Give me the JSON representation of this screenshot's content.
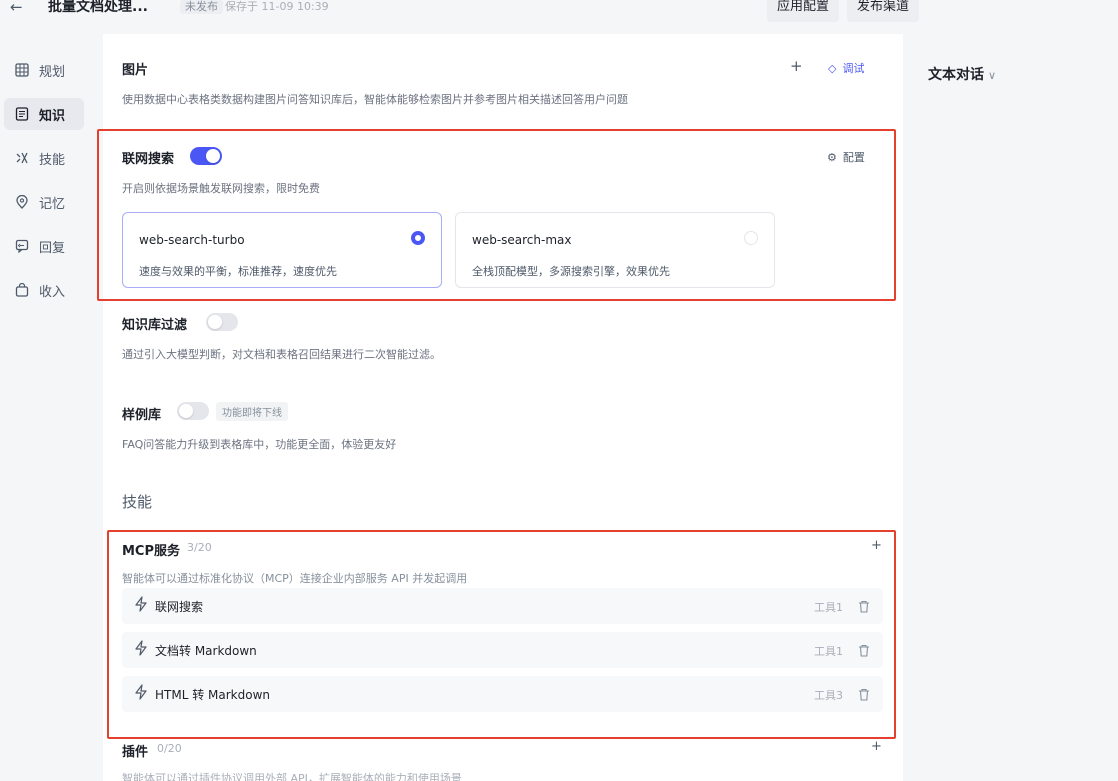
{
  "topbar": {
    "back_icon": "arrow-left-icon",
    "title": "批量文档处理...",
    "status": "未发布",
    "saved": "保存于 11-09 10:39",
    "app_config_label": "应用配置",
    "publish_label": "发布渠道"
  },
  "nav": {
    "items": [
      {
        "label": "规划",
        "icon": "grid-icon",
        "active": false
      },
      {
        "label": "知识",
        "icon": "book-icon",
        "active": true
      },
      {
        "label": "技能",
        "icon": "skill-icon",
        "active": false
      },
      {
        "label": "记忆",
        "icon": "memory-icon",
        "active": false
      },
      {
        "label": "回复",
        "icon": "reply-icon",
        "active": false
      },
      {
        "label": "收入",
        "icon": "bag-icon",
        "active": false
      }
    ]
  },
  "image_section": {
    "title": "图片",
    "desc": "使用数据中心表格类数据构建图片问答知识库后，智能体能够检索图片并参考图片相关描述回答用户问题",
    "add_icon": "plus-icon",
    "debug_label": "调试"
  },
  "web_search": {
    "title": "联网搜索",
    "enabled": true,
    "desc": "开启则依据场景触发联网搜索，限时免费",
    "config_label": "配置",
    "models": [
      {
        "name": "web-search-turbo",
        "desc": "速度与效果的平衡，标准推荐，速度优先",
        "selected": true
      },
      {
        "name": "web-search-max",
        "desc": "全栈顶配模型，多源搜索引擎，效果优先",
        "selected": false
      }
    ]
  },
  "kb_filter": {
    "title": "知识库过滤",
    "enabled": false,
    "desc": "通过引入大模型判断，对文档和表格召回结果进行二次智能过滤。"
  },
  "sample_lib": {
    "title": "样例库",
    "enabled": false,
    "tag": "功能即将下线",
    "desc": "FAQ问答能力升级到表格库中，功能更全面，体验更友好"
  },
  "skills_heading": "技能",
  "mcp": {
    "title": "MCP服务",
    "count": "3/20",
    "desc": "智能体可以通过标准化协议（MCP）连接企业内部服务 API 并发起调用",
    "tools": [
      {
        "name": "联网搜索",
        "count": "工具1"
      },
      {
        "name": "文档转 Markdown",
        "count": "工具1"
      },
      {
        "name": "HTML 转 Markdown",
        "count": "工具3"
      }
    ]
  },
  "plugins": {
    "title": "插件",
    "count": "0/20",
    "desc": "智能体可以通过插件协议调用外部 API，扩展智能体的能力和使用场景"
  },
  "right_panel": {
    "title": "文本对话",
    "chevron": "chevron-down-icon"
  },
  "colors": {
    "accent": "#4b57f5",
    "highlight_frame": "#e5402d",
    "background": "#f5f6f8"
  }
}
